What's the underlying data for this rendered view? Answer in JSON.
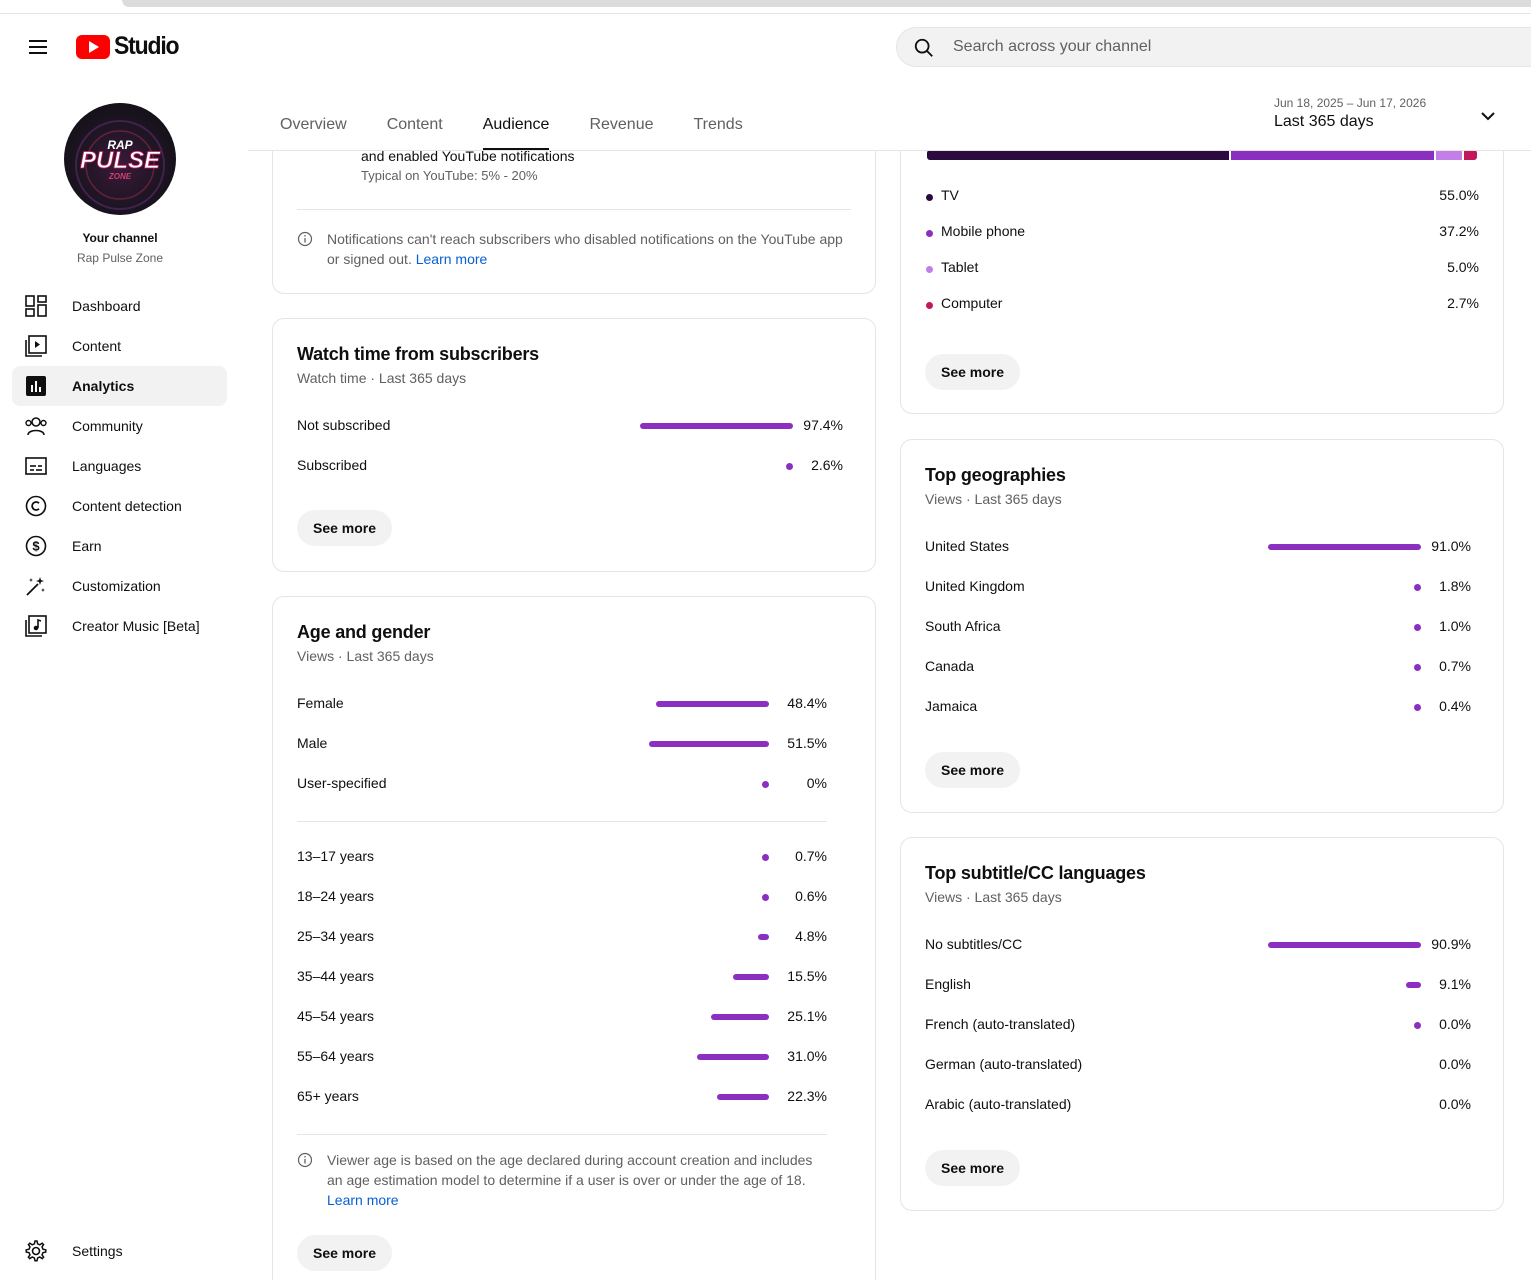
{
  "app": {
    "logo_text": "Studio"
  },
  "search": {
    "placeholder": "Search across your channel"
  },
  "channel": {
    "label": "Your channel",
    "name": "Rap Pulse Zone",
    "avatar_line1": "RAP",
    "avatar_line2": "PULSE",
    "avatar_line3": "ZONE"
  },
  "sidebar": {
    "items": [
      {
        "label": "Dashboard",
        "icon": "dashboard-icon"
      },
      {
        "label": "Content",
        "icon": "content-icon"
      },
      {
        "label": "Analytics",
        "icon": "analytics-icon",
        "active": true
      },
      {
        "label": "Community",
        "icon": "community-icon"
      },
      {
        "label": "Languages",
        "icon": "languages-icon"
      },
      {
        "label": "Content detection",
        "icon": "copyright-icon"
      },
      {
        "label": "Earn",
        "icon": "dollar-icon"
      },
      {
        "label": "Customization",
        "icon": "magic-wand-icon"
      },
      {
        "label": "Creator Music [Beta]",
        "icon": "music-note-icon"
      }
    ],
    "settings": "Settings"
  },
  "tabs": [
    {
      "label": "Overview"
    },
    {
      "label": "Content"
    },
    {
      "label": "Audience",
      "active": true
    },
    {
      "label": "Revenue"
    },
    {
      "label": "Trends"
    }
  ],
  "date_range": {
    "dates": "Jun 18, 2025 – Jun 17, 2026",
    "label": "Last 365 days"
  },
  "notifications_card": {
    "line1": "and enabled YouTube notifications",
    "typical": "Typical on YouTube: 5% - 20%",
    "note": "Notifications can't reach subscribers who disabled notifications on the YouTube app or signed out.",
    "learn_more": "Learn more"
  },
  "watch_time_card": {
    "title": "Watch time from subscribers",
    "subtitle": "Watch time · Last 365 days",
    "rows": [
      {
        "name": "Not subscribed",
        "value": "97.4%",
        "pct": 97.4
      },
      {
        "name": "Subscribed",
        "value": "2.6%",
        "pct": 2.6
      }
    ],
    "see_more": "See more"
  },
  "age_gender_card": {
    "title": "Age and gender",
    "subtitle": "Views · Last 365 days",
    "gender": [
      {
        "name": "Female",
        "value": "48.4%",
        "pct": 48.4
      },
      {
        "name": "Male",
        "value": "51.5%",
        "pct": 51.5
      },
      {
        "name": "User-specified",
        "value": "0%",
        "pct": 0
      }
    ],
    "ages": [
      {
        "name": "13–17 years",
        "value": "0.7%",
        "pct": 0.7
      },
      {
        "name": "18–24 years",
        "value": "0.6%",
        "pct": 0.6
      },
      {
        "name": "25–34 years",
        "value": "4.8%",
        "pct": 4.8
      },
      {
        "name": "35–44 years",
        "value": "15.5%",
        "pct": 15.5
      },
      {
        "name": "45–54 years",
        "value": "25.1%",
        "pct": 25.1
      },
      {
        "name": "55–64 years",
        "value": "31.0%",
        "pct": 31.0
      },
      {
        "name": "65+ years",
        "value": "22.3%",
        "pct": 22.3
      }
    ],
    "note": "Viewer age is based on the age declared during account creation and includes an age estimation model to determine if a user is over or under the age of 18.",
    "learn_more": "Learn more",
    "see_more": "See more"
  },
  "device_card": {
    "items": [
      {
        "name": "TV",
        "value": "55.0%",
        "pct": 55.0,
        "color": "#2b0a3d"
      },
      {
        "name": "Mobile phone",
        "value": "37.2%",
        "pct": 37.2,
        "color": "#8b2fc1"
      },
      {
        "name": "Tablet",
        "value": "5.0%",
        "pct": 5.0,
        "color": "#c47ee8"
      },
      {
        "name": "Computer",
        "value": "2.7%",
        "pct": 2.7,
        "color": "#c2185b"
      }
    ],
    "see_more": "See more"
  },
  "geo_card": {
    "title": "Top geographies",
    "subtitle": "Views · Last 365 days",
    "rows": [
      {
        "name": "United States",
        "value": "91.0%",
        "pct": 91.0
      },
      {
        "name": "United Kingdom",
        "value": "1.8%",
        "pct": 1.8
      },
      {
        "name": "South Africa",
        "value": "1.0%",
        "pct": 1.0
      },
      {
        "name": "Canada",
        "value": "0.7%",
        "pct": 0.7
      },
      {
        "name": "Jamaica",
        "value": "0.4%",
        "pct": 0.4
      }
    ],
    "see_more": "See more"
  },
  "subtitle_card": {
    "title": "Top subtitle/CC languages",
    "subtitle": "Views · Last 365 days",
    "rows": [
      {
        "name": "No subtitles/CC",
        "value": "90.9%",
        "pct": 90.9
      },
      {
        "name": "English",
        "value": "9.1%",
        "pct": 9.1
      },
      {
        "name": "French (auto-translated)",
        "value": "0.0%",
        "pct": 0.01
      },
      {
        "name": "German (auto-translated)",
        "value": "0.0%",
        "pct": 0
      },
      {
        "name": "Arabic (auto-translated)",
        "value": "0.0%",
        "pct": 0
      }
    ],
    "see_more": "See more"
  },
  "colors": {
    "bar": "#8b2fc1",
    "link": "#065fd4",
    "logo_red": "#ff0000"
  }
}
